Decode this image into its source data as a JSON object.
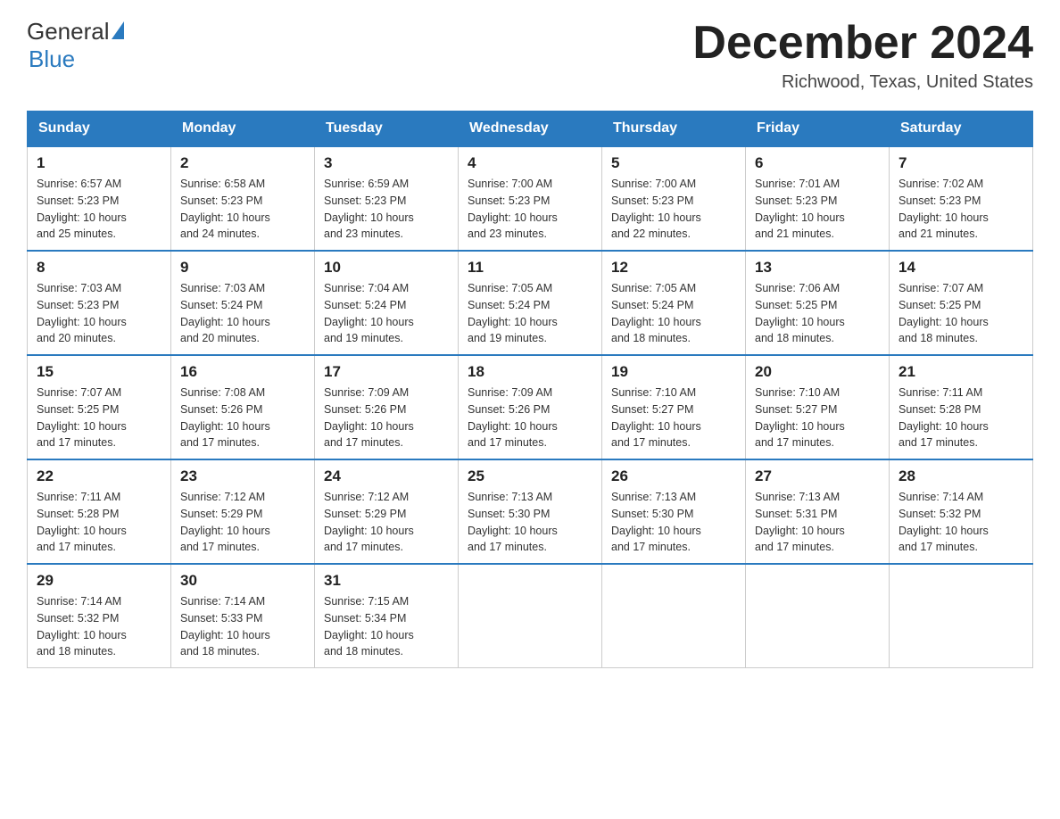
{
  "header": {
    "logo_general": "General",
    "logo_blue": "Blue",
    "month_title": "December 2024",
    "location": "Richwood, Texas, United States"
  },
  "days_of_week": [
    "Sunday",
    "Monday",
    "Tuesday",
    "Wednesday",
    "Thursday",
    "Friday",
    "Saturday"
  ],
  "weeks": [
    [
      {
        "day": "1",
        "sunrise": "6:57 AM",
        "sunset": "5:23 PM",
        "daylight": "10 hours and 25 minutes."
      },
      {
        "day": "2",
        "sunrise": "6:58 AM",
        "sunset": "5:23 PM",
        "daylight": "10 hours and 24 minutes."
      },
      {
        "day": "3",
        "sunrise": "6:59 AM",
        "sunset": "5:23 PM",
        "daylight": "10 hours and 23 minutes."
      },
      {
        "day": "4",
        "sunrise": "7:00 AM",
        "sunset": "5:23 PM",
        "daylight": "10 hours and 23 minutes."
      },
      {
        "day": "5",
        "sunrise": "7:00 AM",
        "sunset": "5:23 PM",
        "daylight": "10 hours and 22 minutes."
      },
      {
        "day": "6",
        "sunrise": "7:01 AM",
        "sunset": "5:23 PM",
        "daylight": "10 hours and 21 minutes."
      },
      {
        "day": "7",
        "sunrise": "7:02 AM",
        "sunset": "5:23 PM",
        "daylight": "10 hours and 21 minutes."
      }
    ],
    [
      {
        "day": "8",
        "sunrise": "7:03 AM",
        "sunset": "5:23 PM",
        "daylight": "10 hours and 20 minutes."
      },
      {
        "day": "9",
        "sunrise": "7:03 AM",
        "sunset": "5:24 PM",
        "daylight": "10 hours and 20 minutes."
      },
      {
        "day": "10",
        "sunrise": "7:04 AM",
        "sunset": "5:24 PM",
        "daylight": "10 hours and 19 minutes."
      },
      {
        "day": "11",
        "sunrise": "7:05 AM",
        "sunset": "5:24 PM",
        "daylight": "10 hours and 19 minutes."
      },
      {
        "day": "12",
        "sunrise": "7:05 AM",
        "sunset": "5:24 PM",
        "daylight": "10 hours and 18 minutes."
      },
      {
        "day": "13",
        "sunrise": "7:06 AM",
        "sunset": "5:25 PM",
        "daylight": "10 hours and 18 minutes."
      },
      {
        "day": "14",
        "sunrise": "7:07 AM",
        "sunset": "5:25 PM",
        "daylight": "10 hours and 18 minutes."
      }
    ],
    [
      {
        "day": "15",
        "sunrise": "7:07 AM",
        "sunset": "5:25 PM",
        "daylight": "10 hours and 17 minutes."
      },
      {
        "day": "16",
        "sunrise": "7:08 AM",
        "sunset": "5:26 PM",
        "daylight": "10 hours and 17 minutes."
      },
      {
        "day": "17",
        "sunrise": "7:09 AM",
        "sunset": "5:26 PM",
        "daylight": "10 hours and 17 minutes."
      },
      {
        "day": "18",
        "sunrise": "7:09 AM",
        "sunset": "5:26 PM",
        "daylight": "10 hours and 17 minutes."
      },
      {
        "day": "19",
        "sunrise": "7:10 AM",
        "sunset": "5:27 PM",
        "daylight": "10 hours and 17 minutes."
      },
      {
        "day": "20",
        "sunrise": "7:10 AM",
        "sunset": "5:27 PM",
        "daylight": "10 hours and 17 minutes."
      },
      {
        "day": "21",
        "sunrise": "7:11 AM",
        "sunset": "5:28 PM",
        "daylight": "10 hours and 17 minutes."
      }
    ],
    [
      {
        "day": "22",
        "sunrise": "7:11 AM",
        "sunset": "5:28 PM",
        "daylight": "10 hours and 17 minutes."
      },
      {
        "day": "23",
        "sunrise": "7:12 AM",
        "sunset": "5:29 PM",
        "daylight": "10 hours and 17 minutes."
      },
      {
        "day": "24",
        "sunrise": "7:12 AM",
        "sunset": "5:29 PM",
        "daylight": "10 hours and 17 minutes."
      },
      {
        "day": "25",
        "sunrise": "7:13 AM",
        "sunset": "5:30 PM",
        "daylight": "10 hours and 17 minutes."
      },
      {
        "day": "26",
        "sunrise": "7:13 AM",
        "sunset": "5:30 PM",
        "daylight": "10 hours and 17 minutes."
      },
      {
        "day": "27",
        "sunrise": "7:13 AM",
        "sunset": "5:31 PM",
        "daylight": "10 hours and 17 minutes."
      },
      {
        "day": "28",
        "sunrise": "7:14 AM",
        "sunset": "5:32 PM",
        "daylight": "10 hours and 17 minutes."
      }
    ],
    [
      {
        "day": "29",
        "sunrise": "7:14 AM",
        "sunset": "5:32 PM",
        "daylight": "10 hours and 18 minutes."
      },
      {
        "day": "30",
        "sunrise": "7:14 AM",
        "sunset": "5:33 PM",
        "daylight": "10 hours and 18 minutes."
      },
      {
        "day": "31",
        "sunrise": "7:15 AM",
        "sunset": "5:34 PM",
        "daylight": "10 hours and 18 minutes."
      },
      null,
      null,
      null,
      null
    ]
  ],
  "labels": {
    "sunrise": "Sunrise: ",
    "sunset": "Sunset: ",
    "daylight": "Daylight: "
  }
}
